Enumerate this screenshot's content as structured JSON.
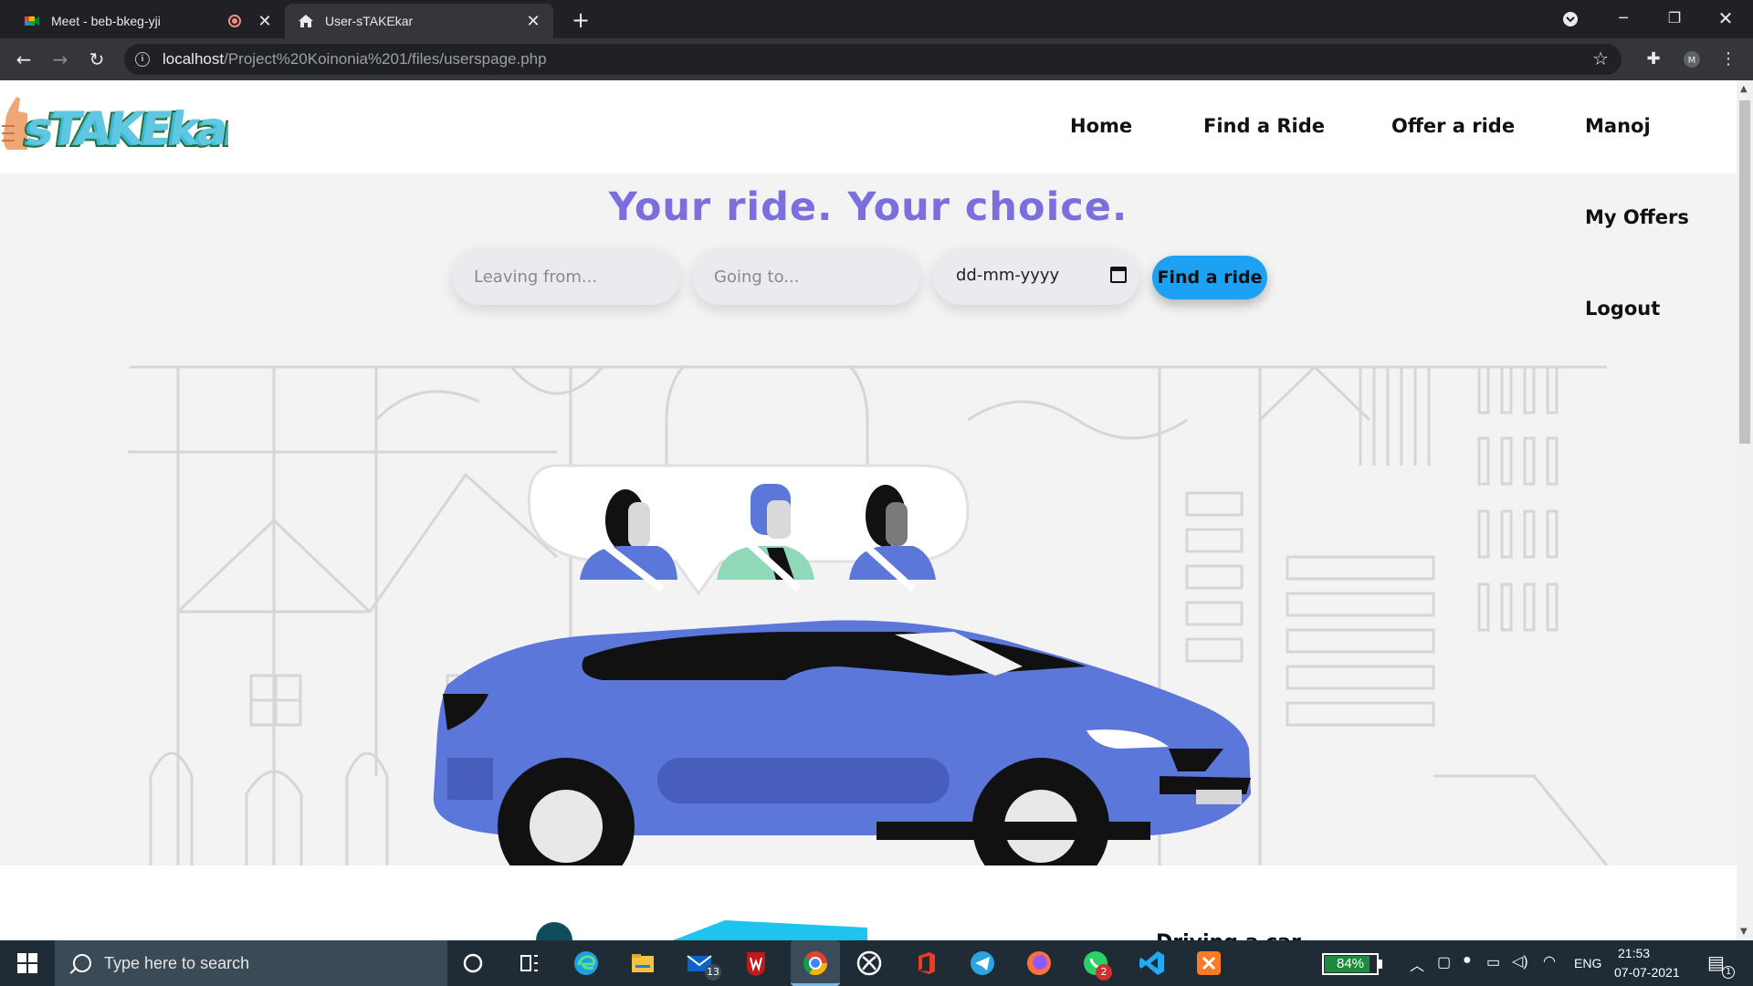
{
  "browser": {
    "tabs": [
      {
        "title": "Meet - beb-bkeg-yji",
        "active": false
      },
      {
        "title": "User-sTAKEkar",
        "active": true
      }
    ],
    "url_host": "localhost",
    "url_path": "/Project%20Koinonia%201/files/userspage.php"
  },
  "site": {
    "logo_text": "sTAKEkar",
    "nav": {
      "home": "Home",
      "find_ride": "Find a Ride",
      "offer_ride": "Offer a ride",
      "user": "Manoj",
      "my_offers": "My Offers",
      "logout": "Logout"
    },
    "hero": {
      "headline": "Your ride. Your choice.",
      "leaving_placeholder": "Leaving from...",
      "going_placeholder": "Going to...",
      "date_placeholder": "dd-mm-yyyy",
      "find_button": "Find a ride"
    },
    "below_fold_heading": "Driving a car"
  },
  "taskbar": {
    "search_placeholder": "Type here to search",
    "mail_badge": "13",
    "whatsapp_badge": "2",
    "battery": "84%",
    "language": "ENG",
    "time": "21:53",
    "date": "07-07-2021",
    "notification_badge": "1"
  },
  "colors": {
    "headline": "#7b6fe0",
    "find_button": "#1da1f2",
    "car": "#5b77d9",
    "hero_bg": "#f3f3f3"
  }
}
